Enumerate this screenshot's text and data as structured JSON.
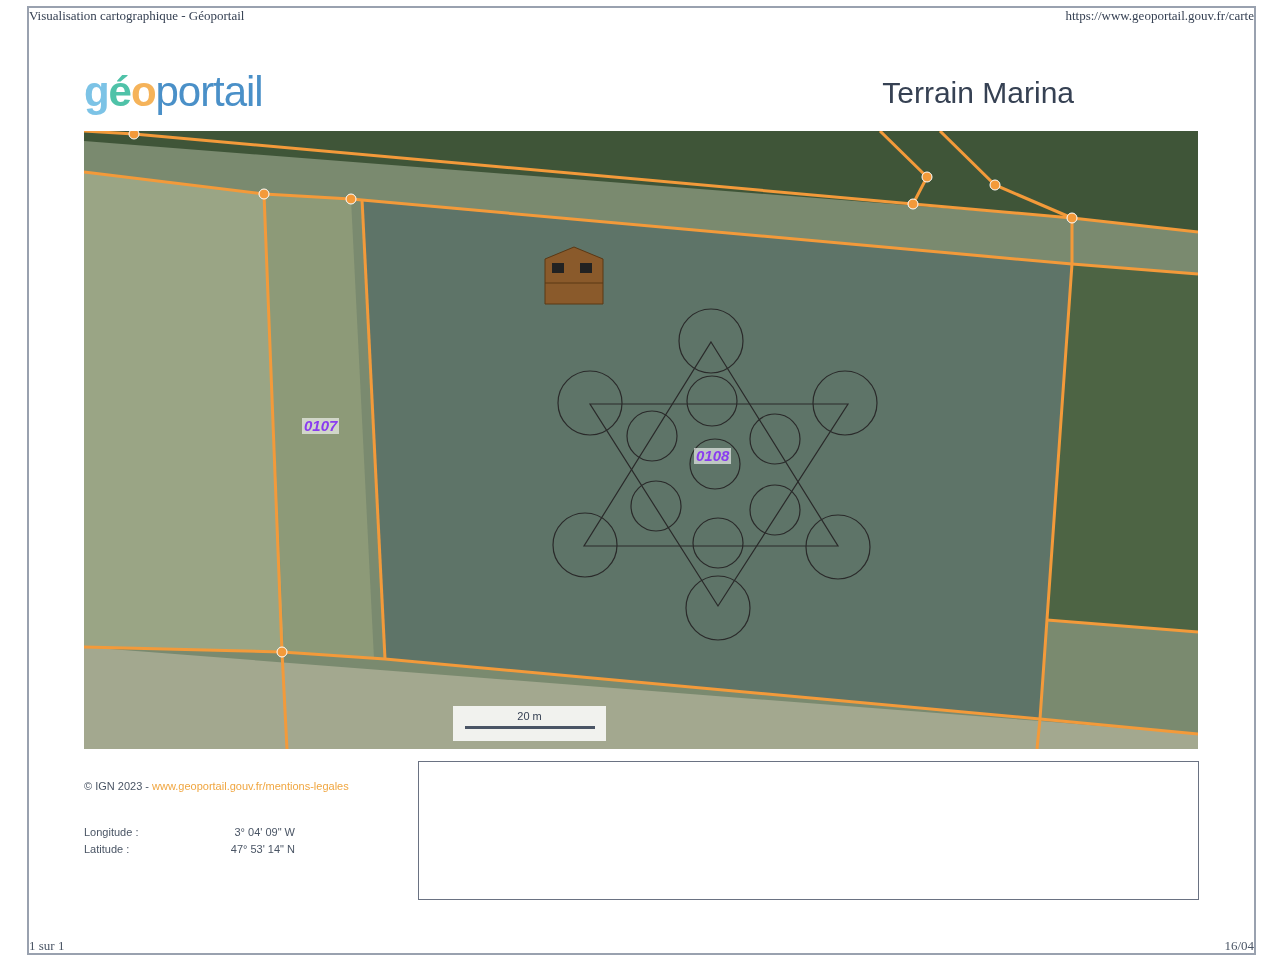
{
  "print_header": {
    "title": "Visualisation cartographique - Géoportail",
    "url": "https://www.geoportail.gouv.fr/carte"
  },
  "logo": [
    {
      "text": "g",
      "color": "#7cc3e6"
    },
    {
      "text": "é",
      "color": "#4fc2a8"
    },
    {
      "text": "o",
      "color": "#f5b35a"
    },
    {
      "text": "portail",
      "color": "#4a90c8"
    }
  ],
  "title": "Terrain Marina",
  "map": {
    "parcels": [
      {
        "label": "0107"
      },
      {
        "label": "0108"
      }
    ],
    "scale_bar": "20 m"
  },
  "attribution": {
    "prefix": "© IGN 2023 - ",
    "link": "www.geoportail.gouv.fr/mentions-legales"
  },
  "coordinates": [
    {
      "label": "Longitude :",
      "value": "3° 04' 09\" W"
    },
    {
      "label": "Latitude :",
      "value": "47° 53' 14\" N"
    }
  ],
  "print_footer": {
    "page": "1 sur 1",
    "date": "16/04"
  }
}
